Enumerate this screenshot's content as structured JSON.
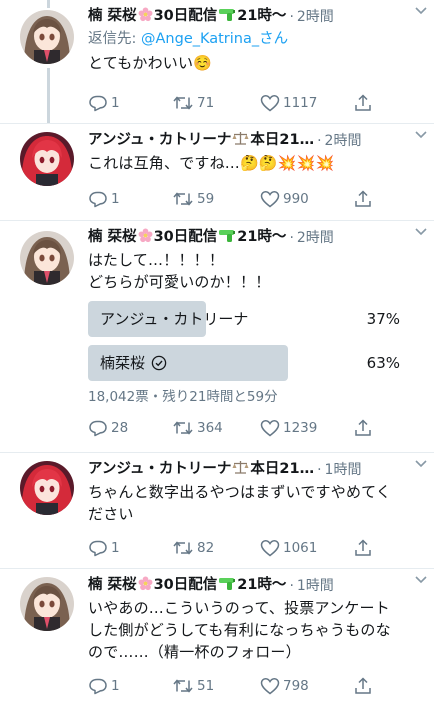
{
  "tweets": [
    {
      "author": {
        "name_pre": "楠 栞桜",
        "name_mid": "30日配信",
        "name_post": "21時〜",
        "badge_icons": [
          "cherry-blossom-icon",
          "water-pistol-icon"
        ]
      },
      "time": "2時間",
      "reply_prefix": "返信先: ",
      "reply_handle": "@Ange_Katrina_さん",
      "text": "とてもかわいい☺️",
      "counts": {
        "replies": "1",
        "retweets": "71",
        "likes": "1117"
      }
    },
    {
      "author": {
        "name_pre": "アンジュ・カトリーナ",
        "name_post": "本日21…",
        "badge_icons": [
          "scales-icon"
        ]
      },
      "time": "2時間",
      "text": "これは互角、ですね…🤔🤔💥💥💥",
      "counts": {
        "replies": "1",
        "retweets": "59",
        "likes": "990"
      }
    },
    {
      "author": {
        "name_pre": "楠 栞桜",
        "name_mid": "30日配信",
        "name_post": "21時〜",
        "badge_icons": [
          "cherry-blossom-icon",
          "water-pistol-icon"
        ]
      },
      "time": "2時間",
      "text": "はたして…！！！！\nどちらが可愛いのか！！！",
      "poll": {
        "options": [
          {
            "label": "アンジュ・カトリーナ",
            "percent": "37%",
            "fraction": 0.37,
            "winner": false
          },
          {
            "label": "楠栞桜",
            "percent": "63%",
            "fraction": 0.63,
            "winner": true
          }
        ],
        "meta": "18,042票・残り21時間と59分"
      },
      "counts": {
        "replies": "28",
        "retweets": "364",
        "likes": "1239"
      }
    },
    {
      "author": {
        "name_pre": "アンジュ・カトリーナ",
        "name_post": "本日21…",
        "badge_icons": [
          "scales-icon"
        ]
      },
      "time": "1時間",
      "text": "ちゃんと数字出るやつはまずいですやめてく\nださい",
      "counts": {
        "replies": "1",
        "retweets": "82",
        "likes": "1061"
      }
    },
    {
      "author": {
        "name_pre": "楠 栞桜",
        "name_mid": "30日配信",
        "name_post": "21時〜",
        "badge_icons": [
          "cherry-blossom-icon",
          "water-pistol-icon"
        ]
      },
      "time": "1時間",
      "text": "いやあの…こういうのって、投票アンケート\nした側がどうしても有利になっちゃうものな\nので……（精一杯のフォロー）",
      "counts": {
        "replies": "1",
        "retweets": "51",
        "likes": "798"
      }
    }
  ],
  "colors": {
    "accent": "#1da1f2",
    "muted": "#657786",
    "poll_bar": "#ccd6dd",
    "divider": "#e6ecf0"
  }
}
